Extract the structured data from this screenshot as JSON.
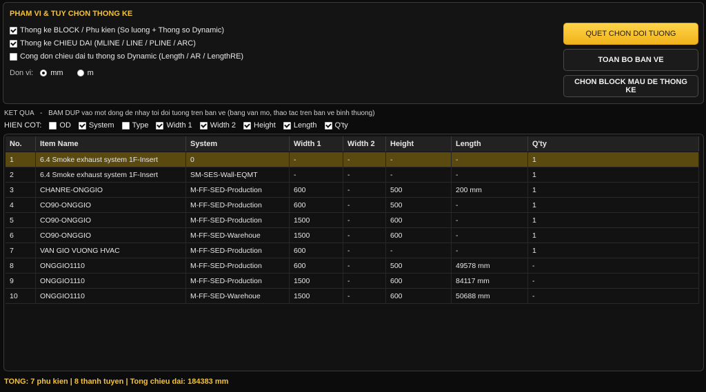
{
  "options": {
    "title": "PHAM VI & TUY CHON THONG KE",
    "items": [
      {
        "label": "Thong ke BLOCK / Phu kien (So luong + Thong so Dynamic)",
        "checked": true
      },
      {
        "label": "Thong ke CHIEU DAI (MLINE / LINE / PLINE / ARC)",
        "checked": true
      },
      {
        "label": "Cong don chieu dai tu thong so Dynamic (Length / AR / LengthRE)",
        "checked": false
      }
    ],
    "unit_label": "Don vi:",
    "units": [
      {
        "label": "mm",
        "selected": true
      },
      {
        "label": "m",
        "selected": false
      }
    ]
  },
  "buttons": {
    "select_objects": "QUET CHON DOI TUONG",
    "whole_drawing": "TOAN BO BAN VE",
    "choose_block": "CHON BLOCK MAU DE THONG KE"
  },
  "result": {
    "label": "KET QUA",
    "hint": "BAM DUP vao mot dong de nhay toi doi tuong tren ban ve (bang van mo, thao tac tren ban ve binh thuong)"
  },
  "show_columns": {
    "label": "HIEN COT:",
    "items": [
      {
        "label": "OD",
        "checked": false
      },
      {
        "label": "System",
        "checked": true
      },
      {
        "label": "Type",
        "checked": false
      },
      {
        "label": "Width 1",
        "checked": true
      },
      {
        "label": "Width 2",
        "checked": true
      },
      {
        "label": "Height",
        "checked": true
      },
      {
        "label": "Length",
        "checked": true
      },
      {
        "label": "Q'ty",
        "checked": true
      }
    ]
  },
  "table": {
    "headers": [
      "No.",
      "Item Name",
      "System",
      "Width 1",
      "Width 2",
      "Height",
      "Length",
      "Q'ty"
    ],
    "selected_row": 0,
    "rows": [
      [
        "1",
        "6.4 Smoke exhaust system 1F-Insert",
        "0",
        "-",
        "-",
        "-",
        "-",
        "1"
      ],
      [
        "2",
        "6.4 Smoke exhaust system 1F-Insert",
        "SM-SES-Wall-EQMT",
        "-",
        "-",
        "-",
        "-",
        "1"
      ],
      [
        "3",
        "CHANRE-ONGGIO",
        "M-FF-SED-Production",
        "600",
        "-",
        "500",
        "200 mm",
        "1"
      ],
      [
        "4",
        "CO90-ONGGIO",
        "M-FF-SED-Production",
        "600",
        "-",
        "500",
        "-",
        "1"
      ],
      [
        "5",
        "CO90-ONGGIO",
        "M-FF-SED-Production",
        "1500",
        "-",
        "600",
        "-",
        "1"
      ],
      [
        "6",
        "CO90-ONGGIO",
        "M-FF-SED-Warehoue",
        "1500",
        "-",
        "600",
        "-",
        "1"
      ],
      [
        "7",
        "VAN GIO VUONG HVAC",
        "M-FF-SED-Production",
        "600",
        "-",
        "-",
        "-",
        "1"
      ],
      [
        "8",
        "ONGGIO1110",
        "M-FF-SED-Production",
        "600",
        "-",
        "500",
        "49578 mm",
        "-"
      ],
      [
        "9",
        "ONGGIO1110",
        "M-FF-SED-Production",
        "1500",
        "-",
        "600",
        "84117 mm",
        "-"
      ],
      [
        "10",
        "ONGGIO1110",
        "M-FF-SED-Warehoue",
        "1500",
        "-",
        "600",
        "50688 mm",
        "-"
      ]
    ]
  },
  "footer": {
    "summary": "TONG: 7 phu kien  |  8 thanh tuyen  |  Tong chieu dai: 184383 mm"
  }
}
